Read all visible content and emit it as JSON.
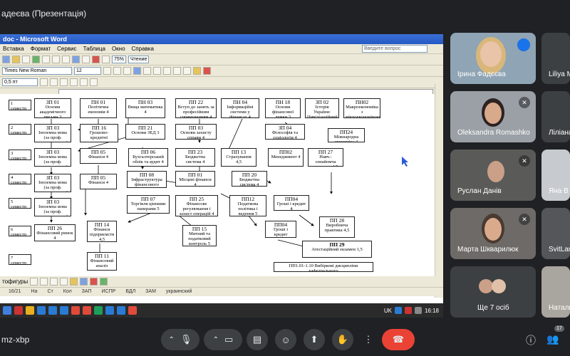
{
  "presenter_title": "адеєва (Презентація)",
  "word": {
    "title": "doc - Microsoft Word",
    "menu": [
      "Вставка",
      "Формат",
      "Сервис",
      "Таблица",
      "Окно",
      "Справка"
    ],
    "ask_placeholder": "Введите вопрос",
    "zoom": "75%",
    "read_label": "Чтение",
    "font_name": "Times New Roman",
    "font_size": "12",
    "indent": "0,5 пт",
    "autoshapes_label": "тофигуры",
    "status": [
      "16/21",
      "На",
      "Ст",
      "Кол",
      "ЗАП",
      "ИСПР",
      "ВДЛ",
      "ЗАМ",
      "украинский"
    ],
    "tray_lang": "UK",
    "clock": "16:18"
  },
  "semesters": [
    "1 семестр",
    "2 семестр",
    "3 семестр",
    "4 семестр",
    "5 семестр",
    "6 семестр",
    "7 семестр"
  ],
  "boxes": [
    {
      "code": "ЗП 01",
      "text": "Основи академічного письма 3"
    },
    {
      "code": "ПН 01",
      "text": "Політична економія 4"
    },
    {
      "code": "ПН 03",
      "text": "Вища математика 4"
    },
    {
      "code": "ПП 22",
      "text": "Вступ до занять за професійним спрямуванням 4"
    },
    {
      "code": "ПН 04",
      "text": "Інформаційні системи у фінансах 4"
    },
    {
      "code": "ПН 18",
      "text": "Основи фінансової думки 3"
    },
    {
      "code": "ЗП 02",
      "text": "Історія України: Цивілізаційний вимір 4"
    },
    {
      "code": "ПН02",
      "text": "Макроекономіка з мікроекономікою 4"
    },
    {
      "code": "ЗП 03",
      "text": "Іноземна мова (за проф. спрямуванням) 3"
    },
    {
      "code": "ПП 16",
      "text": "Грошово-кредитні системи зарубіжних країн 4"
    },
    {
      "code": "ПП 21",
      "text": "Основи ЗЕД 3"
    },
    {
      "code": "ПП 03",
      "text": "Основи захисту справи 4"
    },
    {
      "code": "ЗП 04",
      "text": "Філософія та соціологія 4"
    },
    {
      "code": "ПП24",
      "text": "Міжнародна економіка 4"
    },
    {
      "code": "ЗП 03",
      "text": "Іноземна мова (за проф. спрямуванням) 3"
    },
    {
      "code": "ПП 05",
      "text": "Фінанси 4"
    },
    {
      "code": "ПП 06",
      "text": "Бухгалтерський облік та аудит 4"
    },
    {
      "code": "ПП 23",
      "text": "Бюджетна система 4"
    },
    {
      "code": "ПП 13",
      "text": "Страхування 4,5"
    },
    {
      "code": "ПП02",
      "text": "Менеджмент 4"
    },
    {
      "code": "ПП 27",
      "text": "Навч.-ознайомча практика 4,5"
    },
    {
      "code": "ЗП 03",
      "text": "Іноземна мова (за проф. спрямуванням) 2"
    },
    {
      "code": "ПП 05",
      "text": "Фінанси 4"
    },
    {
      "code": "ПП 08",
      "text": "Інфраструктура фінансового ринку 5"
    },
    {
      "code": "ПП 01",
      "text": "Місцеві фінанси 4"
    },
    {
      "code": "ПП 20",
      "text": "Бюджетна система 4"
    },
    {
      "code": "ЗП 03",
      "text": "Іноземна мова (за проф. спрямуванням) 2"
    },
    {
      "code": "ПП 07",
      "text": "Торгівля цінними паперами 5"
    },
    {
      "code": "ПП 25",
      "text": "Фінансове регулювання і захист операцій 4"
    },
    {
      "code": "ПП12",
      "text": "Податкова політика і ведення 5"
    },
    {
      "code": "ПП04",
      "text": "Гроші і кредит 4"
    },
    {
      "code": "ПП 26",
      "text": "Фінансовий ринок 4"
    },
    {
      "code": "ПП 14",
      "text": "Фінанси підприємств 4,5"
    },
    {
      "code": "ПП 15",
      "text": "Митний та податковий контроль 5"
    },
    {
      "code": "ПП04",
      "text": "Гроші і кредит"
    },
    {
      "code": "ПП 28",
      "text": "Виробнича практика 4,5"
    },
    {
      "code": "ПП 29",
      "text": "Атестаційний екзамен 1,5"
    },
    {
      "code": "ПП 11",
      "text": "Фінансовий аналіз"
    },
    {
      "code": "",
      "text": "ПП1.01-1.10 Вибіркові дисципліни кафедрального"
    }
  ],
  "participants": [
    {
      "name": "Ірина Фадєєва",
      "skin": "#e9c4a8",
      "hair": "#d9b77a",
      "bg": "#8fa4b4",
      "speaking": true
    },
    {
      "name": "Liliya M",
      "skin": "#3c4043",
      "hair": "#3c4043",
      "bg": "#3c4043",
      "speaking": false
    },
    {
      "name": "Oleksandra Romashko",
      "skin": "#d8a98a",
      "hair": "#2d2220",
      "bg": "#9aa0a6",
      "speaking": false
    },
    {
      "name": "Ліліана",
      "skin": "#3c4043",
      "hair": "#3c4043",
      "bg": "#3c4043",
      "speaking": false
    },
    {
      "name": "Руслан Данів",
      "skin": "#caa088",
      "hair": "#3b2d25",
      "bg": "#5a5a58",
      "speaking": false
    },
    {
      "name": "Яна В",
      "skin": "#e1b79a",
      "hair": "#e5c48a",
      "bg": "#c7cbd0",
      "speaking": false
    },
    {
      "name": "Марта Шкварилюк",
      "skin": "#d9aa8c",
      "hair": "#4a3a30",
      "bg": "#6d6a67",
      "speaking": false
    },
    {
      "name": "SvitLan",
      "skin": "#7b6a5c",
      "hair": "#3c4043",
      "bg": "#55565a",
      "speaking": false
    },
    {
      "name": "Ще 7 осіб",
      "skin": "#3c4043",
      "hair": "#3c4043",
      "bg": "#3c4043",
      "speaking": false
    },
    {
      "name": "Натали",
      "skin": "#e0c0a8",
      "hair": "#b8b0a8",
      "bg": "#a9a59f",
      "speaking": false
    }
  ],
  "meeting_code": "mz-xbp",
  "people_count": "17"
}
